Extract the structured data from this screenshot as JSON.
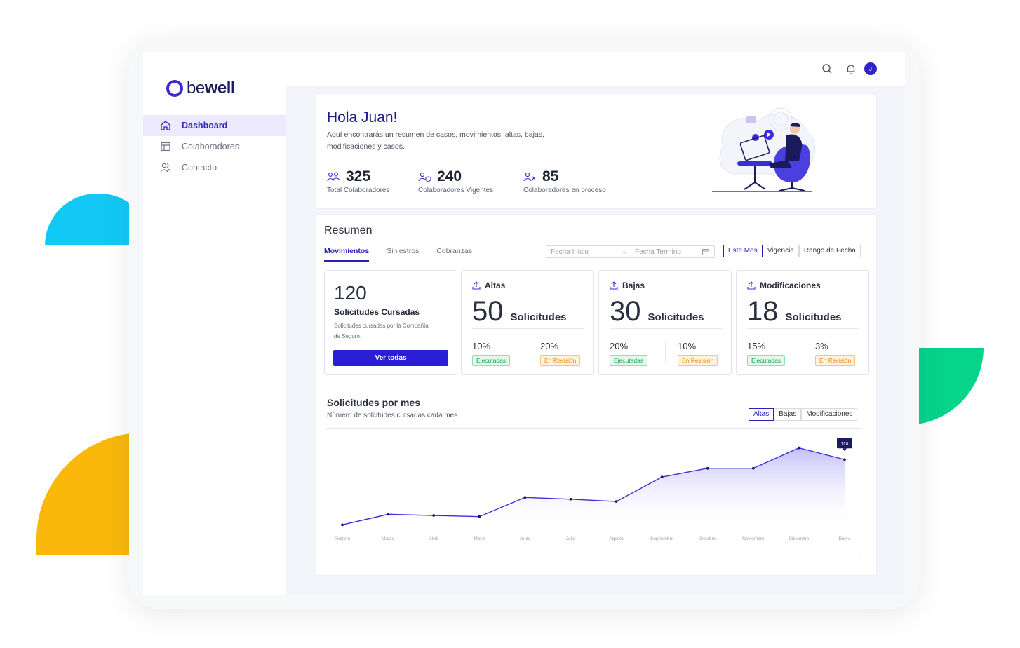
{
  "brand": {
    "logo_prefix": "be",
    "logo_suffix": "well"
  },
  "sidebar": {
    "items": [
      {
        "label": "Dashboard",
        "icon": "home-icon",
        "active": true
      },
      {
        "label": "Colaboradores",
        "icon": "layout-icon",
        "active": false
      },
      {
        "label": "Contacto",
        "icon": "users-icon",
        "active": false
      }
    ]
  },
  "topbar": {
    "avatar_initial": "J"
  },
  "welcome": {
    "title": "Hola Juan!",
    "subtitle": "Aquí encontrarás un resumen de casos, movimientos, altas, bajas, modificaciones y casos.",
    "stats": [
      {
        "value": "325",
        "label": "Total Colaboradores",
        "icon": "users-icon"
      },
      {
        "value": "240",
        "label": "Colaboradores Vigentes",
        "icon": "user-shield-icon"
      },
      {
        "value": "85",
        "label": "Colaboradores en proceso",
        "icon": "user-x-icon"
      }
    ]
  },
  "resumen": {
    "title": "Resumen",
    "tabs": [
      "Movimientos",
      "Siniestros",
      "Cobranzas"
    ],
    "date_start_placeholder": "Fecha Inicio",
    "date_end_placeholder": "Fecha Termino",
    "period_options": [
      "Este Mes",
      "Vigencia",
      "Rango de Fecha"
    ],
    "summary": {
      "value": "120",
      "heading": "Solicitudes Cursadas",
      "description": "Solicitudes cursadas por la Compañía de Seguro.",
      "button": "Ver todas"
    },
    "cards": [
      {
        "title": "Altas",
        "value": "50",
        "unit": "Solicitudes",
        "exec_pct": "10%",
        "exec_label": "Ejecutadas",
        "rev_pct": "20%",
        "rev_label": "En Revisión"
      },
      {
        "title": "Bajas",
        "value": "30",
        "unit": "Solicitudes",
        "exec_pct": "20%",
        "exec_label": "Ejecutadas",
        "rev_pct": "10%",
        "rev_label": "En Revisión"
      },
      {
        "title": "Modificaciones",
        "value": "18",
        "unit": "Solicitudes",
        "exec_pct": "15%",
        "exec_label": "Ejecutadas",
        "rev_pct": "3%",
        "rev_label": "En Revisión"
      }
    ]
  },
  "chart_section": {
    "title": "Solicitudes por mes",
    "subtitle": "Número de solcitudes cursadas cada mes.",
    "toggles": [
      "Altas",
      "Bajas",
      "Modificaciones"
    ],
    "tooltip": "120"
  },
  "chart_data": {
    "type": "area",
    "categories": [
      "Febrero",
      "Marzo",
      "Abril",
      "Mayo",
      "Junio",
      "Julio",
      "Agosto",
      "Septiembre",
      "Octubre",
      "Noviembre",
      "Diciembre",
      "Enero"
    ],
    "values": [
      8,
      26,
      24,
      22,
      55,
      52,
      48,
      90,
      105,
      105,
      140,
      120
    ],
    "ylim": [
      0,
      160
    ],
    "grid": false,
    "colors": {
      "line": "#3b2ed6",
      "fill": "#d9d6fb"
    }
  },
  "colors": {
    "accent": "#2a22b5",
    "brand": "#3d2bd1",
    "blue_shape": "#12c8f5",
    "yellow_shape": "#f9b80a",
    "green_shape": "#05d48a"
  }
}
